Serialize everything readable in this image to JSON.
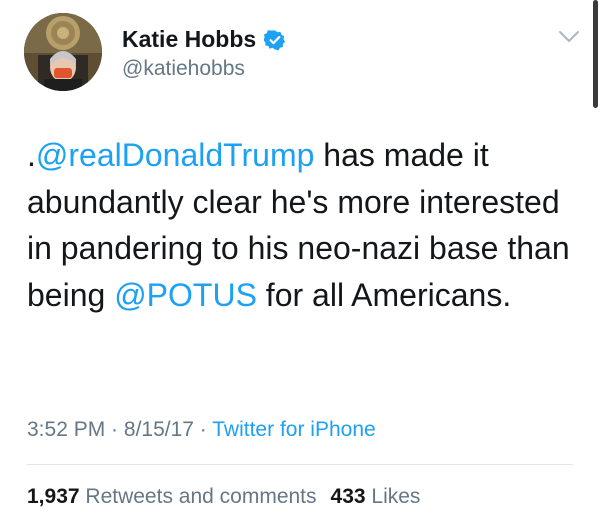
{
  "author": {
    "display_name": "Katie Hobbs",
    "handle": "@katiehobbs",
    "verified": true
  },
  "tweet": {
    "prefix": ".",
    "mention_1": "@realDonaldTrump",
    "text_1": " has made it abundantly clear he's more interested in pandering to his neo-nazi base than being ",
    "mention_2": "@POTUS",
    "text_2": " for all Americans."
  },
  "meta": {
    "time": "3:52 PM",
    "sep_1": " · ",
    "date": "8/15/17",
    "sep_2": " · ",
    "source": "Twitter for iPhone"
  },
  "stats": {
    "retweets_count": "1,937",
    "retweets_label": "Retweets and comments",
    "likes_count": "433",
    "likes_label": "Likes"
  },
  "colors": {
    "link": "#1da1f2",
    "secondary_text": "#657786",
    "primary_text": "#14171a",
    "verified_badge": "#1da1f2"
  },
  "icons": [
    "verified-badge-icon",
    "chevron-down-icon"
  ]
}
